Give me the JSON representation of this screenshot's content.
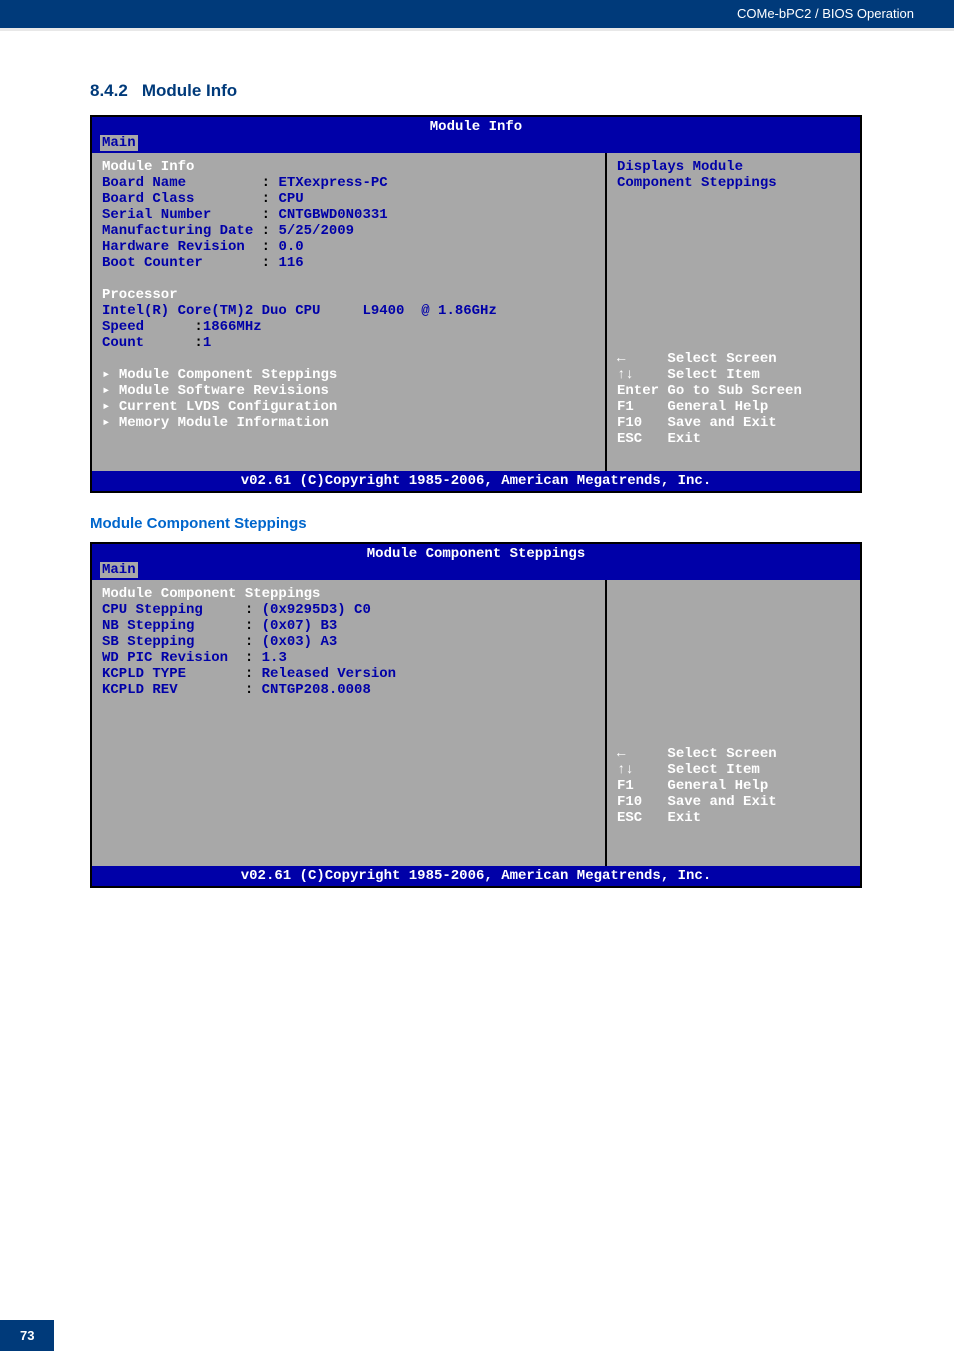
{
  "header": {
    "label": "COMe-bPC2 / BIOS Operation"
  },
  "page_number": "73",
  "section": {
    "number": "8.4.2",
    "title": "Module Info"
  },
  "subsection": {
    "title": "Module Component Steppings"
  },
  "bios1": {
    "title": "Module Info",
    "tab": "Main",
    "section_module": "Module Info",
    "board_name_lbl": "Board Name",
    "board_name_val": "ETXexpress-PC",
    "board_class_lbl": "Board Class",
    "board_class_val": "CPU",
    "serial_lbl": "Serial Number",
    "serial_val": "CNTGBWD0N0331",
    "mfg_lbl": "Manufacturing Date",
    "mfg_val": "5/25/2009",
    "hw_lbl": "Hardware Revision",
    "hw_val": "0.0",
    "boot_lbl": "Boot Counter",
    "boot_val": "116",
    "section_processor": "Processor",
    "cpu_line": "Intel(R) Core(TM)2 Duo CPU     L9400  @ 1.86GHz",
    "speed_lbl": "Speed",
    "speed_val": "1866MHz",
    "count_lbl": "Count",
    "count_val": "1",
    "menu1": "Module Component Steppings",
    "menu2": "Module Software Revisions",
    "menu3": "Current LVDS Configuration",
    "menu4": "Memory Module Information",
    "help1": "Displays Module",
    "help2": "Component Steppings",
    "nav_screen_lbl": "Select Screen",
    "nav_item_lbl": "Select Item",
    "nav_enter_key": "Enter",
    "nav_enter_lbl": "Go to Sub Screen",
    "nav_f1_key": "F1",
    "nav_f1_lbl": "General Help",
    "nav_f10_key": "F10",
    "nav_f10_lbl": "Save and Exit",
    "nav_esc_key": "ESC",
    "nav_esc_lbl": "Exit",
    "footer": "v02.61 (C)Copyright 1985-2006, American Megatrends, Inc."
  },
  "bios2": {
    "title": "Module Component Steppings",
    "tab": "Main",
    "section": "Module Component Steppings",
    "cpu_lbl": "CPU Stepping",
    "cpu_val": "(0x9295D3) C0",
    "nb_lbl": "NB Stepping",
    "nb_val": "(0x07) B3",
    "sb_lbl": "SB Stepping",
    "sb_val": "(0x03) A3",
    "wd_lbl": "WD PIC Revision",
    "wd_val": "1.3",
    "ktype_lbl": "KCPLD TYPE",
    "ktype_val": "Released Version",
    "krev_lbl": "KCPLD REV",
    "krev_val": "CNTGP208.0008",
    "nav_screen_lbl": "Select Screen",
    "nav_item_lbl": "Select Item",
    "nav_f1_key": "F1",
    "nav_f1_lbl": "General Help",
    "nav_f10_key": "F10",
    "nav_f10_lbl": "Save and Exit",
    "nav_esc_key": "ESC",
    "nav_esc_lbl": "Exit",
    "footer": "v02.61 (C)Copyright 1985-2006, American Megatrends, Inc."
  }
}
